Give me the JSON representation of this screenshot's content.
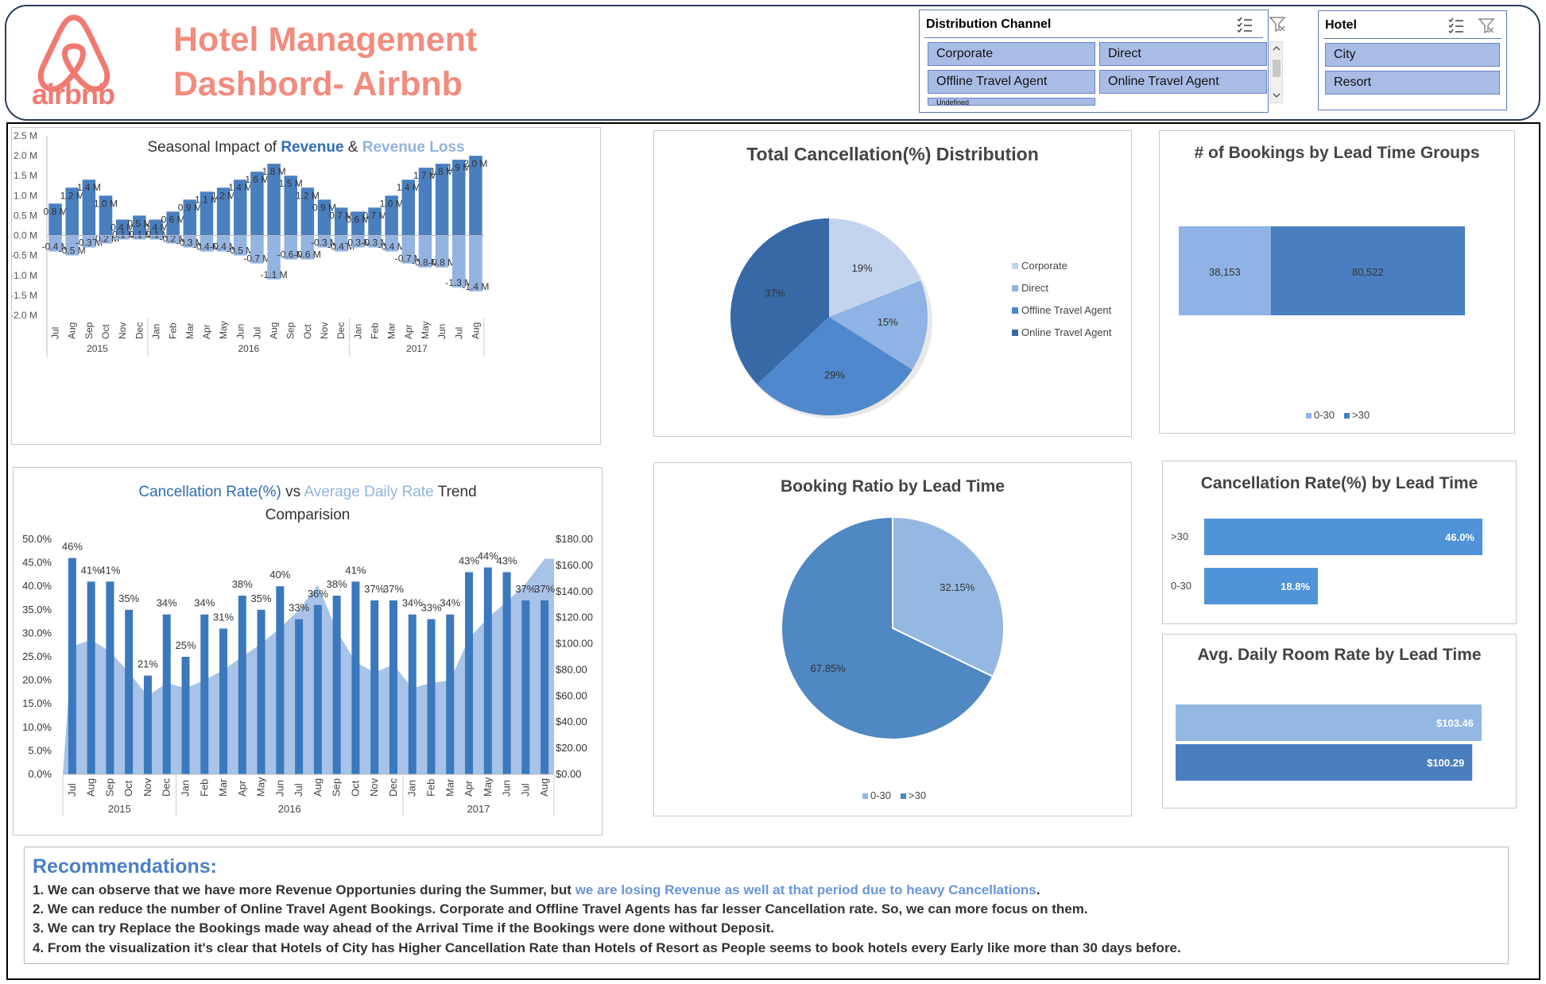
{
  "header": {
    "logo_text": "airbnb",
    "title_line1": "Hotel Management",
    "title_line2": "Dashbord- Airbnb"
  },
  "slicers": {
    "channel": {
      "title": "Distribution Channel",
      "items": [
        "Corporate",
        "Direct",
        "Offline Travel Agent",
        "Online Travel Agent"
      ],
      "partial_item": "Undefined",
      "icons": [
        "multi-select-icon",
        "clear-filter-icon"
      ]
    },
    "hotel": {
      "title": "Hotel",
      "items": [
        "City",
        "Resort"
      ],
      "icons": [
        "multi-select-icon",
        "clear-filter-icon"
      ]
    }
  },
  "colors": {
    "revenue": "#4a7fbf",
    "revenue_loss": "#93b3e0",
    "accent": "#2f6db5",
    "title_coral": "#f28c7e"
  },
  "chart_data": [
    {
      "id": "seasonal",
      "type": "bar",
      "title_parts": [
        "Seasonal Impact of ",
        "Revenue",
        " & ",
        "Revenue Loss"
      ],
      "categories": [
        "Jul",
        "Aug",
        "Sep",
        "Oct",
        "Nov",
        "Dec",
        "Jan",
        "Feb",
        "Mar",
        "Apr",
        "May",
        "Jun",
        "Jul",
        "Aug",
        "Sep",
        "Oct",
        "Nov",
        "Dec",
        "Jan",
        "Feb",
        "Mar",
        "Apr",
        "May",
        "Jun",
        "Jul",
        "Aug"
      ],
      "year_groups": [
        {
          "label": "2015",
          "count": 6
        },
        {
          "label": "2016",
          "count": 12
        },
        {
          "label": "2017",
          "count": 8
        }
      ],
      "series": [
        {
          "name": "Revenue",
          "values": [
            0.8,
            1.2,
            1.4,
            1.0,
            0.4,
            0.5,
            0.4,
            0.6,
            0.9,
            1.1,
            1.2,
            1.4,
            1.6,
            1.8,
            1.5,
            1.2,
            0.9,
            0.7,
            0.6,
            0.7,
            1.0,
            1.4,
            1.7,
            1.8,
            1.9,
            2.0
          ]
        },
        {
          "name": "Revenue Loss",
          "values": [
            -0.4,
            -0.5,
            -0.3,
            -0.2,
            -0.1,
            -0.1,
            -0.1,
            -0.2,
            -0.3,
            -0.4,
            -0.4,
            -0.5,
            -0.7,
            -1.1,
            -0.6,
            -0.6,
            -0.3,
            -0.4,
            -0.3,
            -0.3,
            -0.4,
            -0.7,
            -0.8,
            -0.8,
            -1.3,
            -1.4
          ]
        }
      ],
      "labels_revenue": [
        "0.8 M",
        "1.2 M",
        "1.4 M",
        "1.0 M",
        "0.4 M",
        "0.5 M",
        "0.4 M",
        "0.6 M",
        "0.9 M",
        "1.1 M",
        "1.2 M",
        "1.4 M",
        "1.6 M",
        "1.8 M",
        "1.5 M",
        "1.2 M",
        "0.9 M",
        "0.7 M",
        "0.6 M",
        "0.7 M",
        "1.0 M",
        "1.4 M",
        "1.7 M",
        "1.8 M",
        "1.9 M",
        "2.0 M"
      ],
      "labels_loss": [
        "-0.4 M",
        "-0.5 M",
        "-0.3 M",
        "-0.2 M",
        "-0.1 M",
        "-0.1 M",
        "-0.1 M",
        "-0.2 M",
        "-0.3 M",
        "-0.4 M",
        "-0.4 M",
        "-0.5 M",
        "-0.7 M",
        "-1.1 M",
        "-0.6 M",
        "-0.6 M",
        "-0.3 M",
        "-0.4 M",
        "-0.3 M",
        "-0.3 M",
        "-0.4 M",
        "-0.7 M",
        "-0.8 M",
        "-0.8 M",
        "-1.3 M",
        "-1.4 M"
      ],
      "yticks": [
        "2.5 M",
        "2.0 M",
        "1.5 M",
        "1.0 M",
        "0.5 M",
        "0.0 M",
        "-0.5 M",
        "-1.0 M",
        "-1.5 M",
        "-2.0 M"
      ],
      "ylim": [
        -2.0,
        2.5
      ]
    },
    {
      "id": "cancel_dist",
      "type": "pie",
      "title": "Total Cancellation(%) Distribution",
      "categories": [
        "Corporate",
        "Direct",
        "Offline Travel Agent",
        "Online Travel Agent"
      ],
      "values": [
        19,
        15,
        29,
        37
      ],
      "labels": [
        "19%",
        "15%",
        "29%",
        "37%"
      ],
      "legend_position": "right"
    },
    {
      "id": "bookings_lead",
      "type": "bar",
      "title": "# of Bookings by Lead Time Groups",
      "categories": [
        "0-30",
        ">30"
      ],
      "values": [
        38153,
        80522
      ],
      "labels": [
        "38,153",
        "80,522"
      ],
      "legend_position": "bottom"
    },
    {
      "id": "cancel_adr",
      "type": "bar",
      "title_parts": [
        "Cancellation Rate(%)",
        " vs ",
        "Average Daily Rate",
        " Trend",
        "Comparision"
      ],
      "categories": [
        "Jul",
        "Aug",
        "Sep",
        "Oct",
        "Nov",
        "Dec",
        "Jan",
        "Feb",
        "Mar",
        "Apr",
        "May",
        "Jun",
        "Jul",
        "Aug",
        "Sep",
        "Oct",
        "Nov",
        "Dec",
        "Jan",
        "Feb",
        "Mar",
        "Apr",
        "May",
        "Jun",
        "Jul",
        "Aug"
      ],
      "year_groups": [
        {
          "label": "2015",
          "count": 6
        },
        {
          "label": "2016",
          "count": 12
        },
        {
          "label": "2017",
          "count": 8
        }
      ],
      "series": [
        {
          "name": "Cancellation Rate(%)",
          "values": [
            46,
            41,
            41,
            35,
            21,
            34,
            25,
            34,
            31,
            38,
            35,
            40,
            33,
            36,
            38,
            41,
            37,
            37,
            34,
            33,
            34,
            43,
            44,
            43,
            37,
            37
          ]
        },
        {
          "name": "Average Daily Rate",
          "values": [
            98,
            103,
            94,
            78,
            60,
            70,
            66,
            72,
            80,
            90,
            100,
            112,
            126,
            145,
            110,
            86,
            78,
            84,
            66,
            70,
            72,
            104,
            120,
            132,
            146,
            165
          ]
        }
      ],
      "bar_labels": [
        "46%",
        "41%",
        "41%",
        "35%",
        "21%",
        "34%",
        "25%",
        "34%",
        "31%",
        "38%",
        "35%",
        "40%",
        "33%",
        "36%",
        "38%",
        "41%",
        "37%",
        "37%",
        "34%",
        "33%",
        "34%",
        "43%",
        "44%",
        "43%",
        "37%",
        "37%"
      ],
      "y_left_ticks": [
        "50.0%",
        "45.0%",
        "40.0%",
        "35.0%",
        "30.0%",
        "25.0%",
        "20.0%",
        "15.0%",
        "10.0%",
        "5.0%",
        "0.0%"
      ],
      "y_right_ticks": [
        "$180.00",
        "$160.00",
        "$140.00",
        "$120.00",
        "$100.00",
        "$80.00",
        "$60.00",
        "$40.00",
        "$20.00",
        "$0.00"
      ],
      "ylim_left": [
        0,
        50
      ],
      "ylim_right": [
        0,
        180
      ]
    },
    {
      "id": "booking_ratio",
      "type": "pie",
      "title": "Booking Ratio by Lead Time",
      "categories": [
        "0-30",
        ">30"
      ],
      "values": [
        32.15,
        67.85
      ],
      "labels": [
        "32.15%",
        "67.85%"
      ],
      "legend_position": "bottom"
    },
    {
      "id": "cancel_rate_lead",
      "type": "bar",
      "title": "Cancellation Rate(%) by Lead Time",
      "categories": [
        ">30",
        "0-30"
      ],
      "values": [
        46.0,
        18.8
      ],
      "labels": [
        "46.0%",
        "18.8%"
      ]
    },
    {
      "id": "adr_lead",
      "type": "bar",
      "title": "Avg. Daily Room Rate by Lead Time",
      "categories": [
        "0-30",
        ">30"
      ],
      "values": [
        103.46,
        100.29
      ],
      "labels": [
        "$103.46",
        "$100.29"
      ]
    }
  ],
  "recommendations": {
    "title": "Recommendations:",
    "line1_a": "1. We can observe that we have more Revenue Opportunies during the Summer, but ",
    "line1_b": "we are losing Revenue as well at that period due to heavy Cancellations",
    "line1_c": ".",
    "line2": "2. We can reduce the number of Online Travel Agent Bookings. Corporate and Offline Travel Agents has far lesser Cancellation rate. So, we can more focus on them.",
    "line3": "3. We can try Replace the Bookings made way ahead of the Arrival Time if the Bookings were done without Deposit.",
    "line4": "4. From the visualization it's clear that Hotels of City has Higher Cancellation Rate than Hotels of Resort as People seems to book hotels every Early like more than 30 days before."
  }
}
